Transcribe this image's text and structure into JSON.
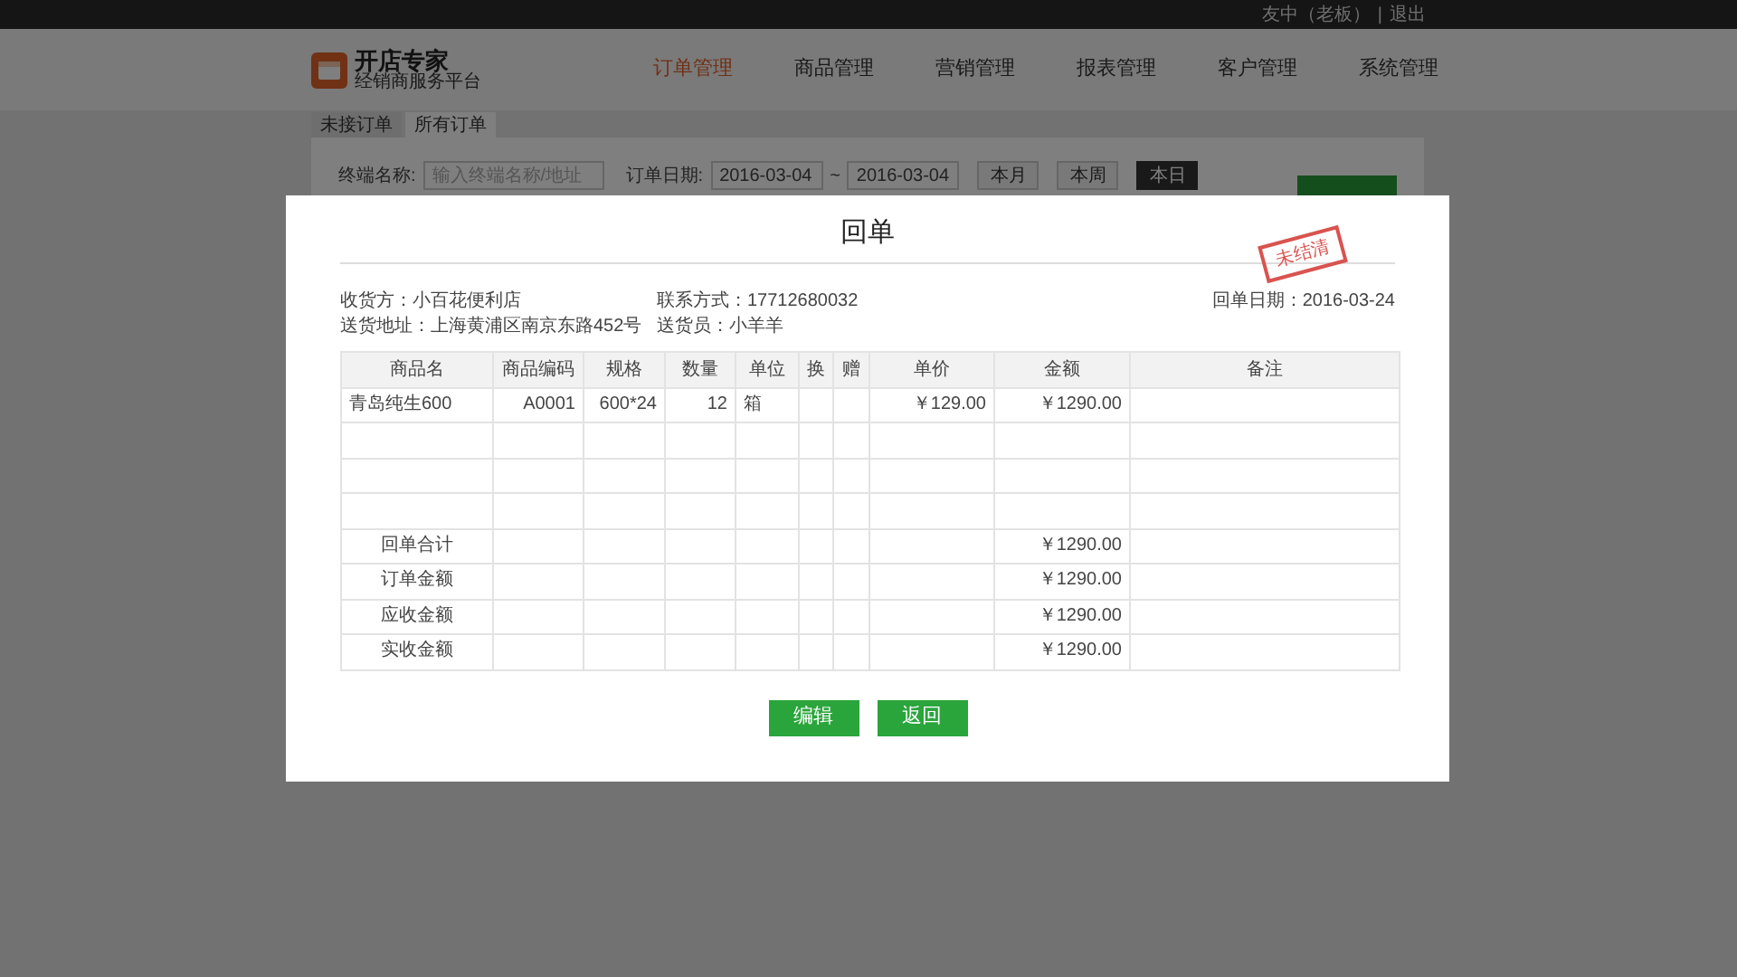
{
  "top_bar": {
    "user": "友中（老板）",
    "separator": "|",
    "logout": "退出"
  },
  "logo": {
    "title": "开店专家",
    "subtitle": "经销商服务平台"
  },
  "nav": [
    {
      "label": "订单管理",
      "selected": true
    },
    {
      "label": "商品管理",
      "selected": false
    },
    {
      "label": "营销管理",
      "selected": false
    },
    {
      "label": "报表管理",
      "selected": false
    },
    {
      "label": "客户管理",
      "selected": false
    },
    {
      "label": "系统管理",
      "selected": false
    }
  ],
  "sub_tabs": [
    {
      "label": "未接订单",
      "selected": false
    },
    {
      "label": "所有订单",
      "selected": true
    }
  ],
  "filters": {
    "terminal_label": "终端名称:",
    "terminal_placeholder": "输入终端名称/地址",
    "date_label": "订单日期:",
    "date_from": "2016-03-04",
    "date_sep": "~",
    "date_to": "2016-03-04",
    "periods": [
      {
        "label": "本月",
        "selected": false
      },
      {
        "label": "本周",
        "selected": false
      },
      {
        "label": "本日",
        "selected": true
      }
    ]
  },
  "dialog": {
    "title": "回单",
    "stamp": "未结清",
    "info": {
      "receiver": "收货方：小百花便利店",
      "contact": "联系方式：17712680032",
      "date": "回单日期：2016-03-24",
      "address": "送货地址：上海黄浦区南京东路452号",
      "courier": "送货员：小羊羊"
    },
    "table": {
      "columns": [
        "商品名",
        "商品编码",
        "规格",
        "数量",
        "单位",
        "换",
        "赠",
        "单价",
        "金额",
        "备注"
      ],
      "rows": [
        {
          "name": "青岛纯生600",
          "code": "A0001",
          "spec": "600*24",
          "qty": "12",
          "unit": "箱",
          "price": "￥129.00",
          "amount": "￥1290.00"
        },
        {},
        {},
        {}
      ],
      "summary": [
        {
          "label": "回单合计",
          "amount": "￥1290.00"
        },
        {
          "label": "订单金额",
          "amount": "￥1290.00"
        },
        {
          "label": "应收金额",
          "amount": "￥1290.00"
        },
        {
          "label": "实收金额",
          "amount": "￥1290.00"
        }
      ]
    },
    "buttons": [
      "编辑",
      "返回"
    ]
  }
}
